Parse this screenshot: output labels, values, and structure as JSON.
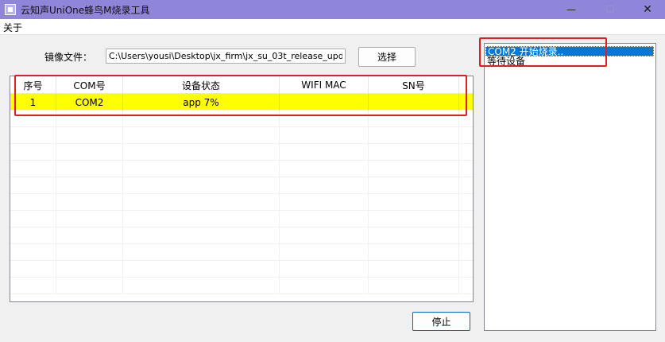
{
  "window": {
    "title": "云知声UniOne蜂鸟M烧录工具"
  },
  "controls": {
    "minimize": "—",
    "maximize": "☐",
    "close": "✕"
  },
  "menu": {
    "items": [
      "关于"
    ]
  },
  "file": {
    "label": "镜像文件：",
    "path": "C:\\Users\\yousi\\Desktop\\jx_firm\\jx_su_03t_release_upd"
  },
  "buttons": {
    "select": "选择",
    "stop": "停止"
  },
  "table": {
    "columns": [
      "序号",
      "COM号",
      "设备状态",
      "WIFI MAC",
      "SN号"
    ],
    "rows": [
      {
        "index": "1",
        "com": "COM2",
        "status": "app 7%",
        "mac": "",
        "sn": ""
      }
    ]
  },
  "log": {
    "items": [
      "COM2 开始烧录..",
      "等待设备"
    ]
  },
  "colors": {
    "titlebar": "#8f86d9",
    "row_highlight": "#ffff00",
    "selection": "#0078d7",
    "annotation": "#e02020"
  }
}
